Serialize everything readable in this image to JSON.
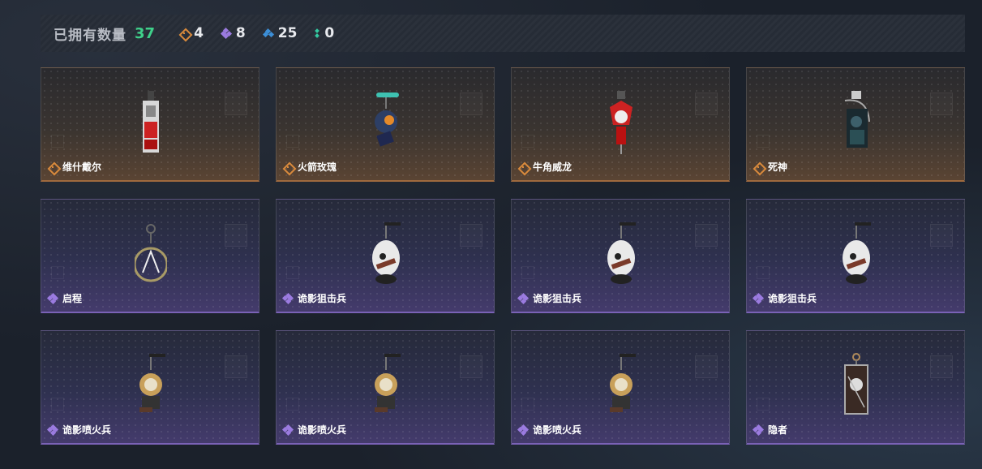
{
  "header": {
    "owned_label": "已拥有数量",
    "owned_count": "37",
    "rarity_counts": {
      "gold": "4",
      "purple": "8",
      "blue": "25",
      "green": "0"
    }
  },
  "colors": {
    "gold": "#d98a3c",
    "purple": "#9b7be0",
    "blue": "#3c8fd8",
    "green": "#33c9a0",
    "owned_count": "#3fd08a"
  },
  "cards": [
    {
      "name": "维什戴尔",
      "rarity": "gold",
      "icon": "vishdel-pendant-icon"
    },
    {
      "name": "火箭玫瑰",
      "rarity": "gold",
      "icon": "rocket-rose-pendant-icon"
    },
    {
      "name": "牛角威龙",
      "rarity": "gold",
      "icon": "horned-dragon-pendant-icon"
    },
    {
      "name": "死神",
      "rarity": "gold",
      "icon": "reaper-pendant-icon"
    },
    {
      "name": "启程",
      "rarity": "purple",
      "icon": "ring-pendant-icon"
    },
    {
      "name": "诡影狙击兵",
      "rarity": "purple",
      "icon": "shadow-sniper-pendant-icon"
    },
    {
      "name": "诡影狙击兵",
      "rarity": "purple",
      "icon": "shadow-sniper-pendant-icon"
    },
    {
      "name": "诡影狙击兵",
      "rarity": "purple",
      "icon": "shadow-sniper-pendant-icon"
    },
    {
      "name": "诡影喷火兵",
      "rarity": "purple",
      "icon": "shadow-flamethrower-pendant-icon"
    },
    {
      "name": "诡影喷火兵",
      "rarity": "purple",
      "icon": "shadow-flamethrower-pendant-icon"
    },
    {
      "name": "诡影喷火兵",
      "rarity": "purple",
      "icon": "shadow-flamethrower-pendant-icon"
    },
    {
      "name": "隐者",
      "rarity": "purple",
      "icon": "hermit-card-pendant-icon"
    }
  ]
}
